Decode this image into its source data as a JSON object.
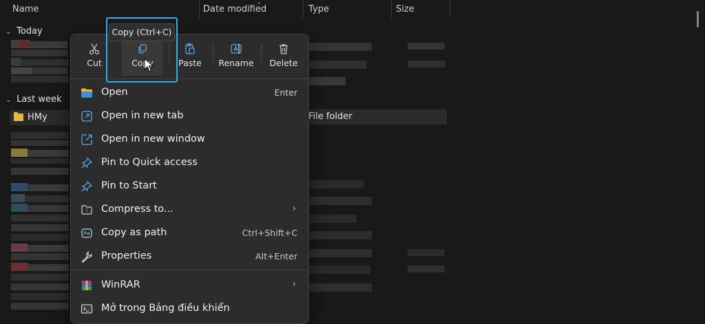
{
  "columns": {
    "name": "Name",
    "date_modified": "Date modified",
    "type": "Type",
    "size": "Size"
  },
  "groups": {
    "today": "Today",
    "last_week": "Last week"
  },
  "folder": {
    "name": "HMy",
    "type": "File folder"
  },
  "context_menu": {
    "toolbar": {
      "cut": "Cut",
      "copy": "Copy",
      "paste": "Paste",
      "rename": "Rename",
      "delete": "Delete"
    },
    "tooltip": "Copy (Ctrl+C)",
    "items": [
      {
        "label": "Open",
        "shortcut": "Enter",
        "icon": "folder-open-icon"
      },
      {
        "label": "Open in new tab",
        "shortcut": "",
        "icon": "new-tab-icon"
      },
      {
        "label": "Open in new window",
        "shortcut": "",
        "icon": "new-window-icon"
      },
      {
        "label": "Pin to Quick access",
        "shortcut": "",
        "icon": "pin-icon"
      },
      {
        "label": "Pin to Start",
        "shortcut": "",
        "icon": "pin-icon"
      },
      {
        "label": "Compress to...",
        "shortcut": "",
        "icon": "zip-icon"
      },
      {
        "label": "Copy as path",
        "shortcut": "Ctrl+Shift+C",
        "icon": "copy-path-icon"
      },
      {
        "label": "Properties",
        "shortcut": "Alt+Enter",
        "icon": "wrench-icon"
      },
      {
        "label": "WinRAR",
        "shortcut": "",
        "icon": "winrar-icon"
      },
      {
        "label": "Mở trong Bảng điều khiển",
        "shortcut": "",
        "icon": "terminal-icon"
      }
    ]
  },
  "colors": {
    "accent": "#29b3e8",
    "background": "#191919",
    "menu": "#2c2c2c",
    "icon_blue": "#5aa9e6",
    "folder": "#e8b83a"
  }
}
